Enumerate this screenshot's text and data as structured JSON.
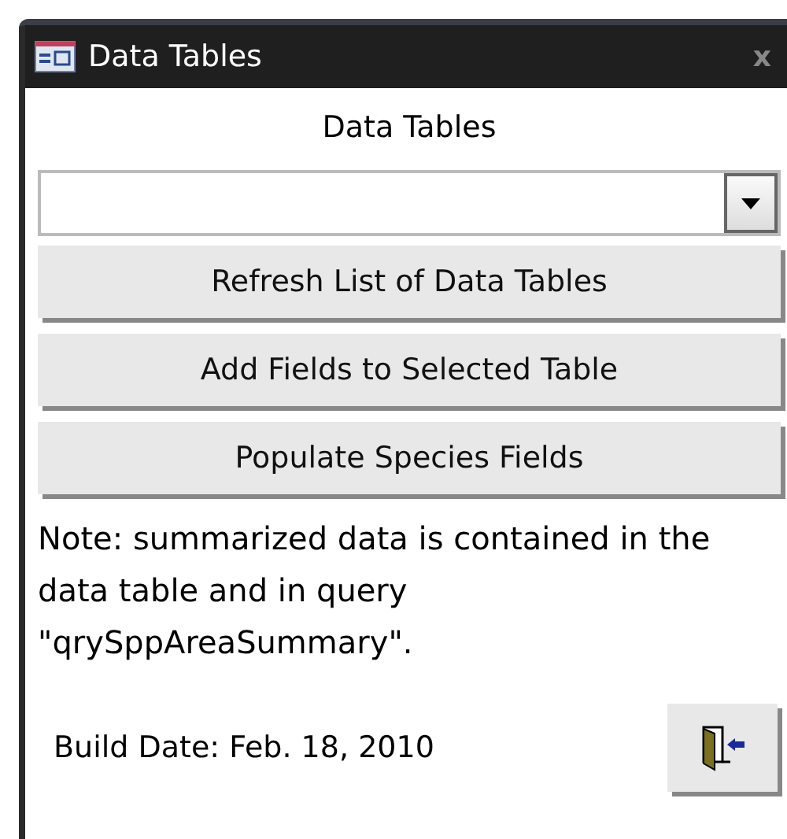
{
  "window": {
    "title": "Data Tables",
    "close": "x"
  },
  "heading": "Data Tables",
  "buttons": [
    "Refresh List of Data Tables",
    "Add Fields to Selected Table",
    "Populate Species Fields"
  ],
  "note": "Note: summarized data is contained in the data table and in query \"qrySppAreaSummary\".",
  "build_date": "Build Date: Feb. 18, 2010"
}
